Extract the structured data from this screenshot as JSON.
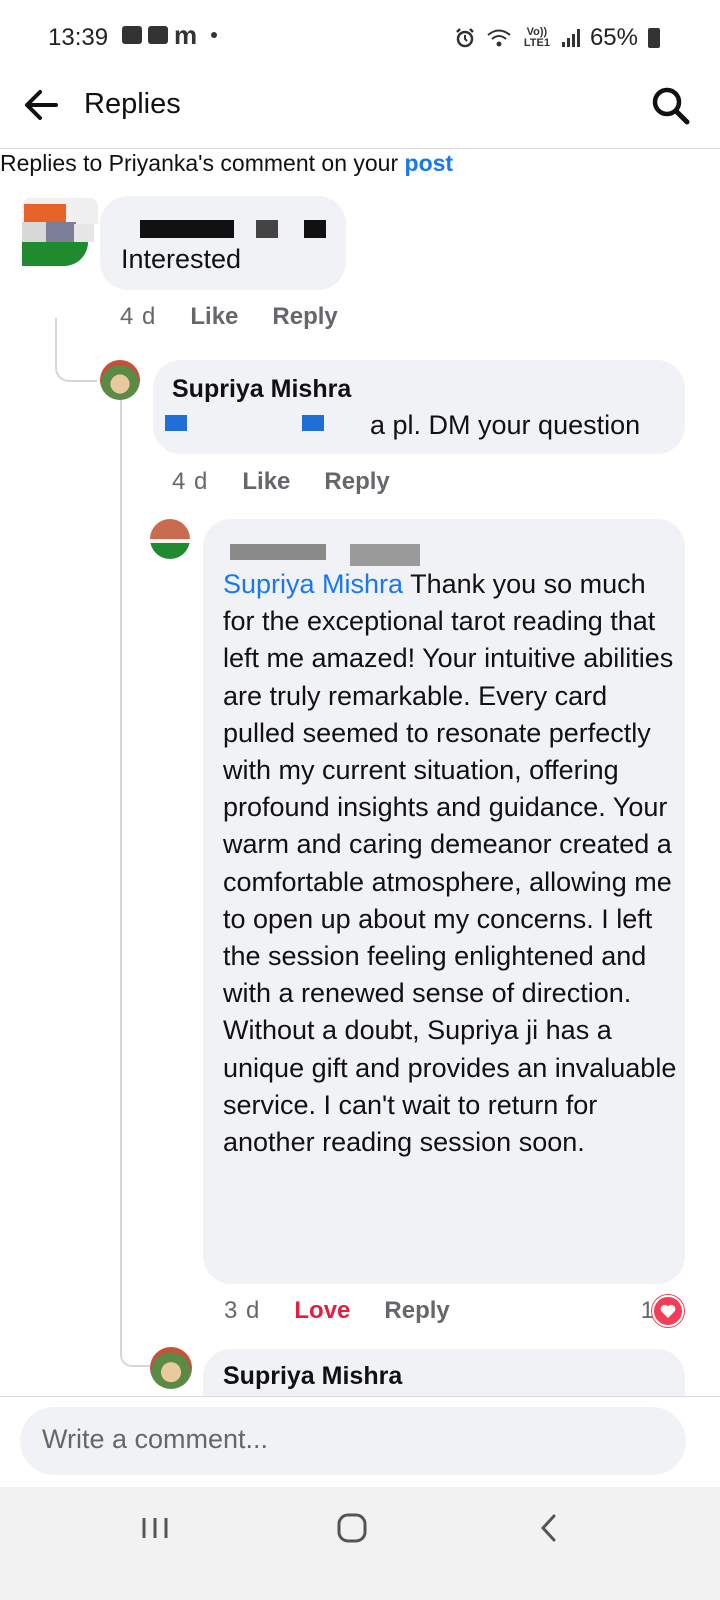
{
  "status_bar": {
    "time": "13:39",
    "notification_letter": "m",
    "network_label": "Vo)) LTE1",
    "battery": "65%"
  },
  "header": {
    "title": "Replies"
  },
  "subheader": {
    "prefix": "Replies to Priyanka's comment on your ",
    "link": "post"
  },
  "comments": [
    {
      "text": "Interested",
      "time": "4 d",
      "like": "Like",
      "reply": "Reply"
    },
    {
      "author": "Supriya Mishra",
      "text_visible": "a pl. DM your question",
      "time": "4 d",
      "like": "Like",
      "reply": "Reply"
    },
    {
      "mention": "Supriya Mishra",
      "text": " Thank you so much for the exceptional tarot reading that left me amazed! Your intuitive abilities are truly remarkable. Every card pulled seemed to resonate perfectly with my current situation, offering profound insights and guidance. Your warm and caring demeanor created a comfortable atmosphere, allowing me to open up about my concerns. I left the session feeling enlightened and with a renewed sense of direction. Without a doubt, Supriya ji has a unique gift and provides an invaluable service. I can't wait to return for another reading session soon.",
      "time": "3 d",
      "reaction_label": "Love",
      "reply": "Reply",
      "reaction_count": "1"
    },
    {
      "author": "Supriya Mishra"
    }
  ],
  "composer": {
    "placeholder": "Write a comment..."
  },
  "icons": {
    "back": "back-arrow-icon",
    "search": "search-icon",
    "reaction": "heart-icon",
    "nav": [
      "recents-icon",
      "home-icon",
      "back-icon"
    ]
  },
  "colors": {
    "link": "#1877f2",
    "love": "#e41e3f",
    "bubble": "#f0f2f5",
    "meta": "#65676b"
  }
}
